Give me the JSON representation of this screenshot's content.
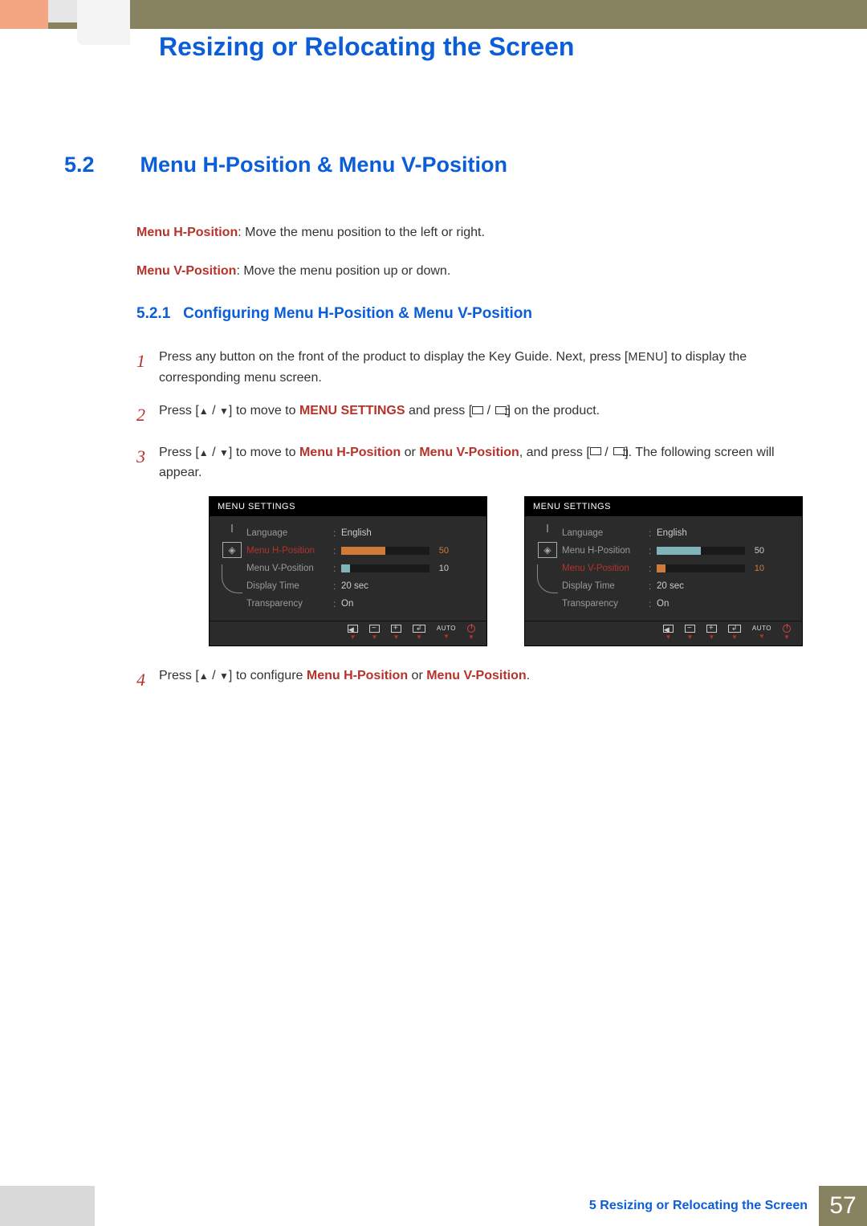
{
  "header": {
    "title": "Resizing or Relocating the Screen"
  },
  "section": {
    "number": "5.2",
    "title": "Menu H-Position & Menu V-Position"
  },
  "defs": {
    "h_label": "Menu H-Position",
    "h_text": ": Move the menu position to the left or right.",
    "v_label": "Menu V-Position",
    "v_text": ": Move the menu position up or down."
  },
  "subsection": {
    "number": "5.2.1",
    "title": "Configuring Menu H-Position & Menu V-Position"
  },
  "steps": {
    "s1": {
      "n": "1",
      "a": "Press any button on the front of the product to display the Key Guide. Next, press [",
      "menu": "MENU",
      "b": "] to display the corresponding menu screen."
    },
    "s2": {
      "n": "2",
      "a": "Press [",
      "b": "] to move to ",
      "ms": "MENU SETTINGS",
      "c": " and press [",
      "d": "] on the product."
    },
    "s3": {
      "n": "3",
      "a": "Press [",
      "b": "] to move to ",
      "h": "Menu H-Position",
      "or": " or ",
      "v": "Menu V-Position",
      "c": ", and press [",
      "d": "]. The following screen will appear."
    },
    "s4": {
      "n": "4",
      "a": "Press [",
      "b": "] to configure ",
      "h": "Menu H-Position",
      "or": " or ",
      "v": "Menu V-Position",
      "dot": "."
    }
  },
  "osd": {
    "title": "MENU SETTINGS",
    "items": {
      "language": "Language",
      "h": "Menu H-Position",
      "v": "Menu V-Position",
      "dt": "Display Time",
      "tr": "Transparency"
    },
    "vals": {
      "language": "English",
      "h": "50",
      "v": "10",
      "dt": "20 sec",
      "tr": "On"
    },
    "auto": "AUTO"
  },
  "footer": {
    "chapter": "5",
    "text": "Resizing or Relocating the Screen",
    "page": "57"
  }
}
